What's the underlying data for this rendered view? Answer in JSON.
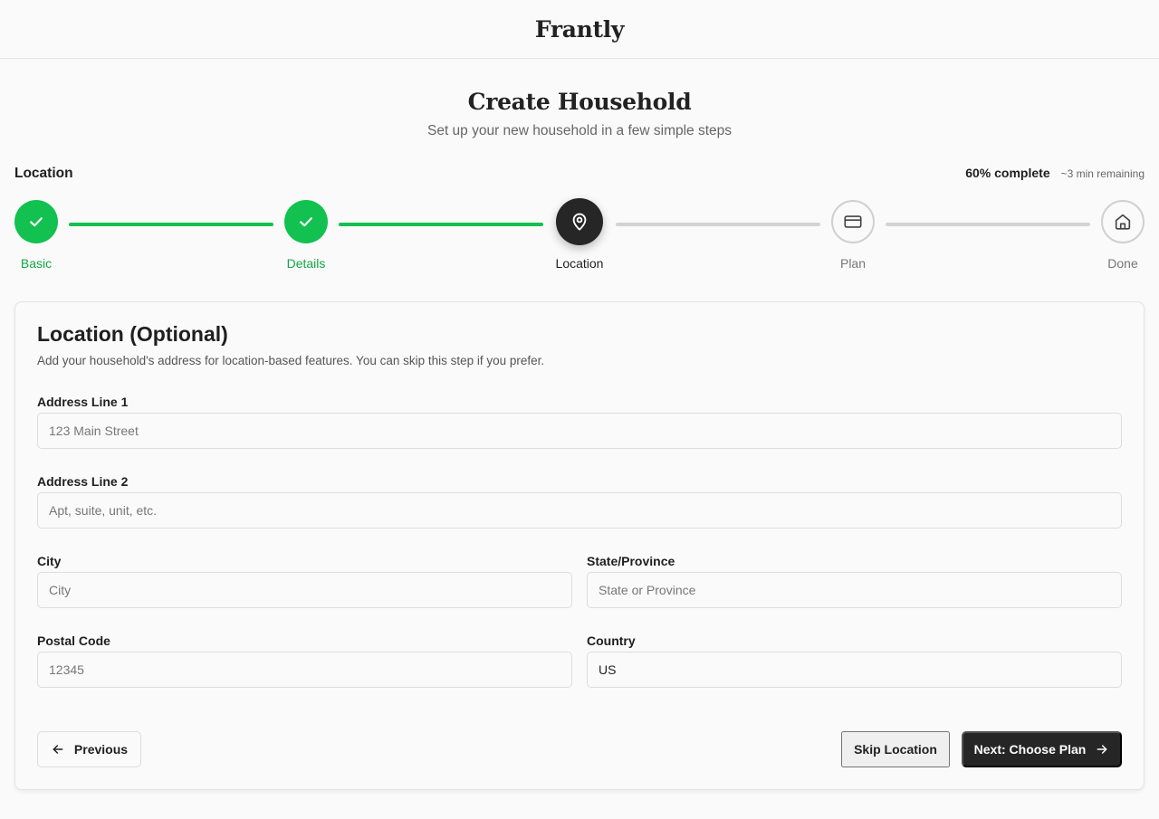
{
  "app": {
    "brand": "Frantly"
  },
  "page": {
    "title": "Create Household",
    "subtitle": "Set up your new household in a few simple steps"
  },
  "progress": {
    "current_step": "Location",
    "percent_text": "60% complete",
    "remaining_text": "~3 min remaining",
    "percent": 60
  },
  "steps": [
    {
      "label": "Basic",
      "status": "done",
      "icon": "check-icon"
    },
    {
      "label": "Details",
      "status": "done",
      "icon": "check-icon"
    },
    {
      "label": "Location",
      "status": "current",
      "icon": "map-pin-icon"
    },
    {
      "label": "Plan",
      "status": "todo",
      "icon": "credit-card-icon"
    },
    {
      "label": "Done",
      "status": "todo",
      "icon": "home-icon"
    }
  ],
  "form": {
    "title": "Location (Optional)",
    "description": "Add your household's address for location-based features. You can skip this step if you prefer.",
    "address1": {
      "label": "Address Line 1",
      "placeholder": "123 Main Street",
      "value": ""
    },
    "address2": {
      "label": "Address Line 2",
      "placeholder": "Apt, suite, unit, etc.",
      "value": ""
    },
    "city": {
      "label": "City",
      "placeholder": "City",
      "value": ""
    },
    "state": {
      "label": "State/Province",
      "placeholder": "State or Province",
      "value": ""
    },
    "postal": {
      "label": "Postal Code",
      "placeholder": "12345",
      "value": ""
    },
    "country": {
      "label": "Country",
      "placeholder": "",
      "value": "US"
    }
  },
  "actions": {
    "previous_label": "Previous",
    "skip_label": "Skip Location",
    "next_label": "Next: Choose Plan"
  },
  "colors": {
    "success": "#12c150",
    "dark": "#262626",
    "muted": "#d4d4d4"
  }
}
